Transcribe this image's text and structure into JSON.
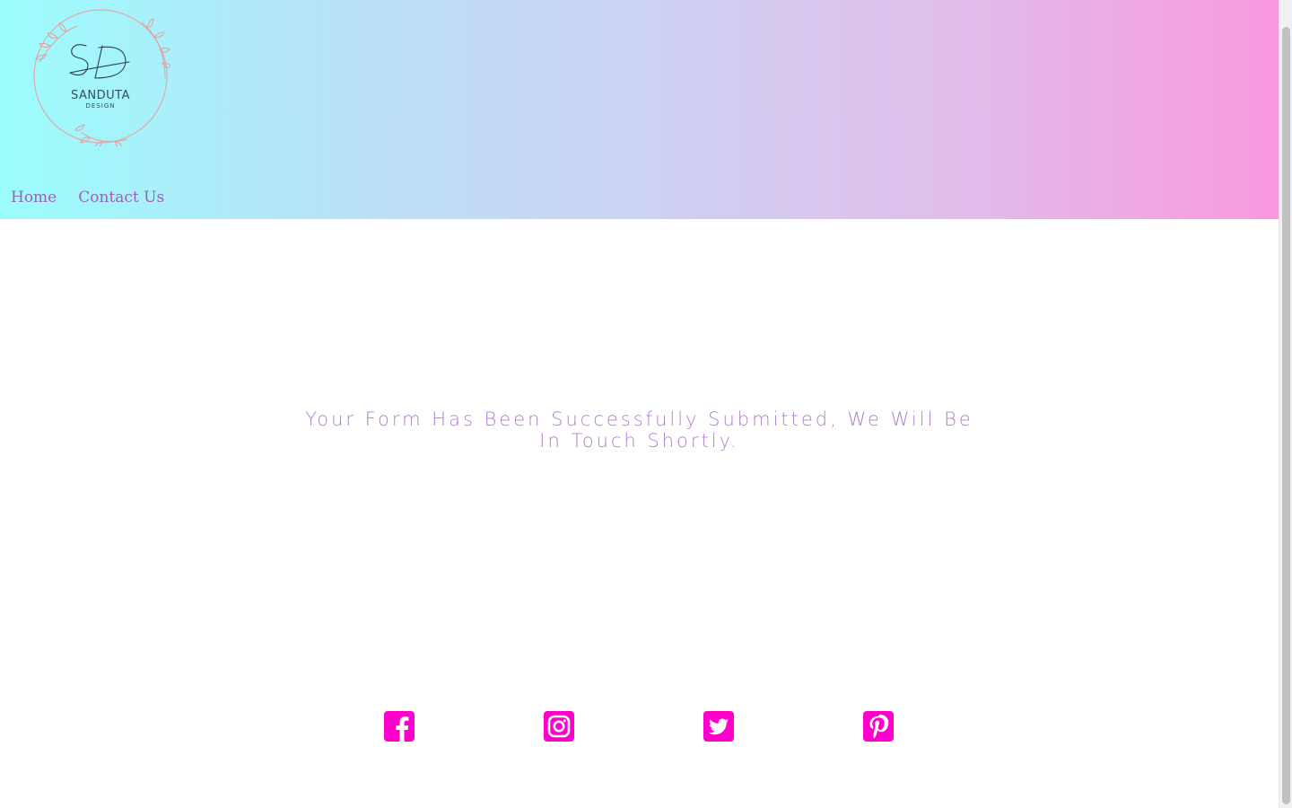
{
  "header": {
    "logo": {
      "monogram": "SD",
      "brand": "SANDUTA",
      "subtitle": "DESIGN"
    },
    "nav": {
      "items": [
        {
          "label": "Home"
        },
        {
          "label": "Contact Us"
        }
      ]
    }
  },
  "main": {
    "message": "Your Form Has Been Successfully Submitted, We Will Be In Touch Shortly."
  },
  "social": {
    "color": "#ff00cc",
    "icons": [
      "facebook-icon",
      "instagram-icon",
      "twitter-icon",
      "pinterest-icon"
    ]
  },
  "colors": {
    "nav_text": "#a05fb8",
    "message_text": "#b27ed0",
    "gradient_start": "#9bfdfc",
    "gradient_end": "#f998e0"
  }
}
